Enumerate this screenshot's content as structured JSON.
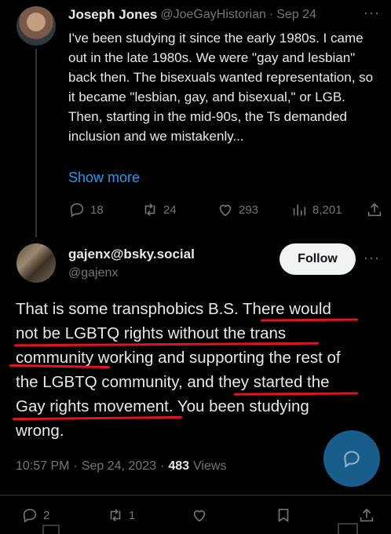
{
  "tweet1": {
    "display_name": "Joseph Jones",
    "handle": "@JoeGayHistorian",
    "separator": "·",
    "date": "Sep 24",
    "more": "···",
    "text": "I've been studying it since the early 1980s. I came out in the late 1980s. We were \"gay and lesbian\" back then. The bisexuals wanted representation, so it became \"lesbian, gay, and bisexual,\" or LGB. Then, starting in the mid-90s, the Ts demanded inclusion and we mistakenly...",
    "show_more": "Show more",
    "replies": "18",
    "retweets": "24",
    "likes": "293",
    "views": "8,201"
  },
  "tweet2": {
    "display_name": "gajenx@bsky.social",
    "handle": "@gajenx",
    "follow_label": "Follow",
    "more": "···",
    "lines": [
      "That is some transphobics B.S. There would",
      "not be LGBTQ rights without the trans",
      "community working and supporting the rest of",
      "the LGBTQ community, and they started the",
      "Gay rights movement. You been studying",
      "wrong."
    ],
    "time": "10:57 PM",
    "sep": "·",
    "date": "Sep 24, 2023",
    "sep2": "·",
    "views_count": "483",
    "views_label": "Views"
  },
  "bottom_bar": {
    "replies": "2",
    "retweets": "1"
  },
  "colors": {
    "accent": "#1d9bf0",
    "underline": "#e0151f",
    "muted": "#71767b"
  }
}
